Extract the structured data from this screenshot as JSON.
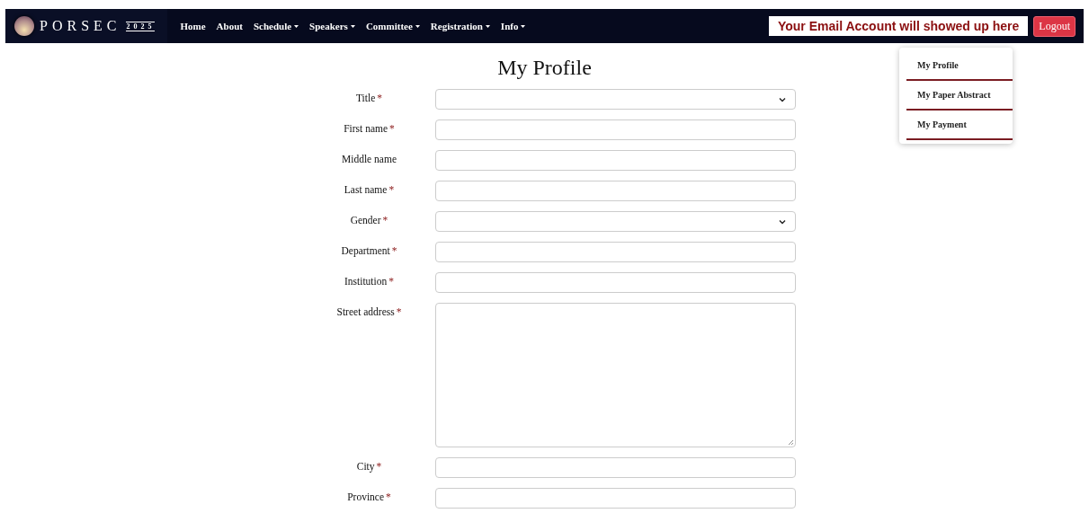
{
  "navbar": {
    "logo": {
      "name": "PORSEC",
      "year": "2025"
    },
    "menu": [
      {
        "label": "Home",
        "dropdown": false
      },
      {
        "label": "About",
        "dropdown": false
      },
      {
        "label": "Schedule",
        "dropdown": true
      },
      {
        "label": "Speakers",
        "dropdown": true
      },
      {
        "label": "Committee",
        "dropdown": true
      },
      {
        "label": "Registration",
        "dropdown": true
      },
      {
        "label": "Info",
        "dropdown": true
      }
    ],
    "account": "Your Email Account will showed up here",
    "logout": "Logout"
  },
  "account_menu": [
    {
      "label": "My Profile"
    },
    {
      "label": "My Paper Abstract"
    },
    {
      "label": "My Payment"
    }
  ],
  "page_title": "My Profile",
  "fields": [
    {
      "label": "Title",
      "marker": "*",
      "kind": "select"
    },
    {
      "label": "First name",
      "marker": "*",
      "kind": "input"
    },
    {
      "label": "Middle name",
      "kind": "input"
    },
    {
      "label": "Last name",
      "marker": "*",
      "kind": "input"
    },
    {
      "label": "Gender",
      "marker": "*",
      "kind": "select"
    },
    {
      "label": "Department",
      "marker": "*",
      "kind": "input"
    },
    {
      "label": "Institution",
      "marker": "*",
      "kind": "input"
    },
    {
      "label": "Street address",
      "marker": "*",
      "kind": "textarea"
    },
    {
      "label": "City",
      "marker": "*",
      "kind": "input"
    },
    {
      "label": "Province",
      "marker": "*",
      "kind": "input"
    }
  ]
}
